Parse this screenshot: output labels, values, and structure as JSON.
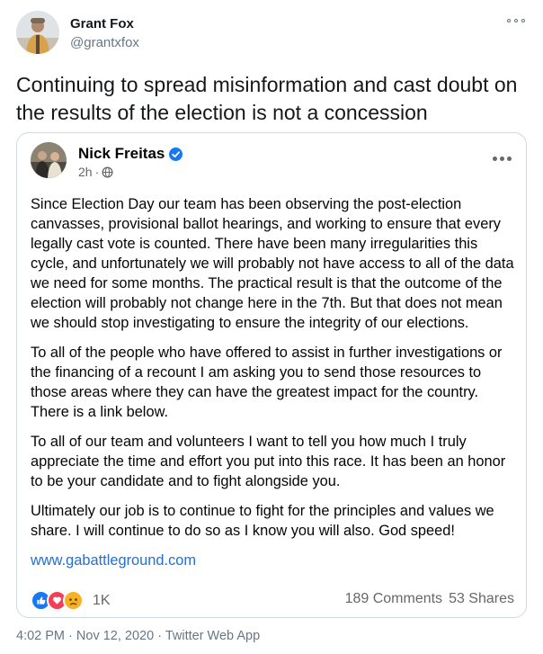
{
  "tweet": {
    "author_name": "Grant Fox",
    "author_handle": "@grantxfox",
    "text": "Continuing to spread misinformation and cast doubt on the results of the election is not a concession",
    "time": "4:02 PM",
    "date": "Nov 12, 2020",
    "separator": "·",
    "source": "Twitter Web App"
  },
  "embedded_post": {
    "author_name": "Nick Freitas",
    "age": "2h",
    "separator": "·",
    "paragraphs": [
      "Since Election Day our team has been observing the post-election canvasses, provisional ballot hearings, and working to ensure that every legally cast vote is counted. There have been many irregularities this cycle, and unfortunately we will probably not have access to all of the data we need for some months. The practical result is that the outcome of the election will probably not change here in the 7th. But that does not mean we should stop investigating to ensure the integrity of our elections.",
      "To all of the people who have offered to assist in further investigations or the financing of a recount I am asking you to send those resources to those areas where they can have the greatest impact for the country. There is a link below.",
      "To all of our team and volunteers I want to tell you how much I truly appreciate the time and effort you put into this race. It has been an honor to be your candidate and to fight alongside you.",
      "Ultimately our job is to continue to fight for the principles and values we share. I will continue to do so as I know you will also. God speed!"
    ],
    "link": "www.gabattleground.com",
    "reaction_count": "1K",
    "comments": "189 Comments",
    "shares": "53 Shares"
  },
  "colors": {
    "twitter_text": "#14171a",
    "twitter_muted": "#657786",
    "facebook_blue": "#1877f2",
    "facebook_link": "#216fdb",
    "facebook_muted": "#65676b",
    "card_border": "#cfd9de"
  },
  "icons": [
    "more-options-icon",
    "verified-badge-icon",
    "globe-icon",
    "more-horizontal-icon",
    "like-reaction-icon",
    "love-reaction-icon",
    "sad-reaction-icon"
  ]
}
